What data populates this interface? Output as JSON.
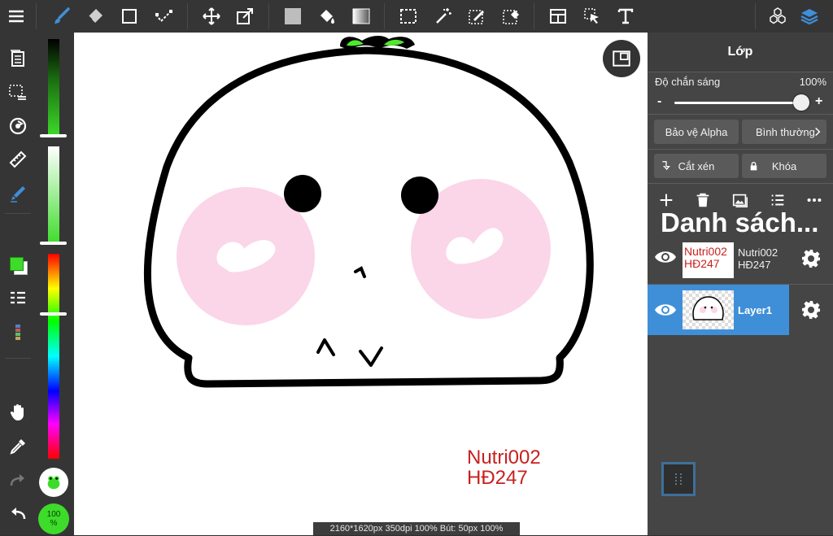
{
  "panel": {
    "title": "Lớp",
    "opacity_label": "Độ chắn sáng",
    "opacity_value": "100%",
    "opacity_level": 1.0,
    "minus": "-",
    "plus": "+",
    "alpha_protect": "Bảo vệ Alpha",
    "blend_mode": "Bình thường",
    "clipping": "Cắt xén",
    "lock": "Khóa",
    "list_title": "Danh sách...",
    "layers": [
      {
        "thumb_text_1": "Nutri002",
        "thumb_text_2": "HĐ247",
        "name_1": "Nutri002",
        "name_2": "HĐ247",
        "selected": false
      },
      {
        "name_1": "Layer1",
        "selected": true
      }
    ]
  },
  "left": {
    "zoom_label": "100\n%"
  },
  "canvas": {
    "watermark_1": "Nutri002",
    "watermark_2": "HĐ247"
  },
  "status": "2160*1620px 350dpi 100% Bút: 50px 100%",
  "colors": {
    "accent_blue": "#3f8fd8",
    "primary_color": "#3ddc2a",
    "watermark": "#c8201e",
    "blush": "#fbd5e8"
  },
  "icons": [
    "menu-icon",
    "brush-icon",
    "eraser-icon",
    "rectangle-icon",
    "pen-curve-icon",
    "move-icon",
    "transform-icon",
    "fill-color-icon",
    "bucket-icon",
    "gradient-icon",
    "select-rect-icon",
    "magic-wand-icon",
    "select-pen-icon",
    "select-eraser-icon",
    "layout-icon",
    "pointer-icon",
    "text-icon",
    "material-icon",
    "layers-icon"
  ]
}
